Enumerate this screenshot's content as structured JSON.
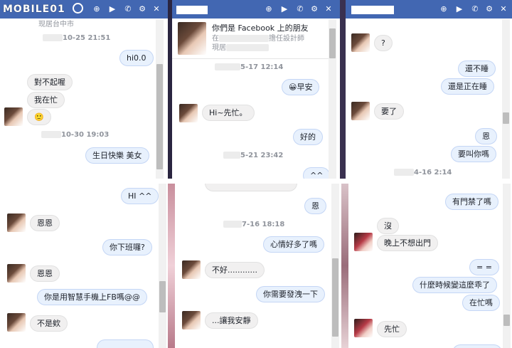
{
  "watermark": {
    "text": "MOBILE01"
  },
  "p1": {
    "top_text": "现居台中市",
    "stamp1": "10-25 21:51",
    "m1": "hi0.0",
    "m2": "對不起喔",
    "m3": "我在忙",
    "m4": "🙂",
    "stamp2": "10-30 19:03",
    "m5": "生日快樂 美女"
  },
  "p2": {
    "profile_line1": "你們是 Facebook 上的朋友",
    "profile_line2": "在",
    "profile_line2b": "擔任設計師",
    "profile_line3": "現居",
    "stamp1": "5-17 12:14",
    "m1": "😀早安",
    "m2": "Hi~先忙。",
    "m3": "好的",
    "stamp2": "5-21 23:42",
    "m4": "^^"
  },
  "p3": {
    "m1": "?",
    "m2": "還不睡",
    "m3": "還是正在睡",
    "m4": "要了",
    "m5": "恩",
    "m6": "要叫你嗎",
    "stamp1": "4-16 2:14"
  },
  "p4": {
    "m1": "HI ^^",
    "m2": "恩恩",
    "m3": "你下班囉?",
    "m4": "恩恩",
    "m5": "你是用智慧手機上FB嗎@@",
    "m6": "不是欸"
  },
  "p5": {
    "m1": "恩",
    "stamp1": "7-16 18:18",
    "m2": "心情好多了嗎",
    "m3": "不好............",
    "m4": "你需要發洩一下",
    "m5": "...讓我安靜"
  },
  "p6": {
    "m1": "有門禁了嗎",
    "m2": "沒",
    "m3": "晚上不想出門",
    "m4": "= =",
    "m5": "什麼時候變這麼乖了",
    "m6": "在忙嗎",
    "m7": "先忙"
  }
}
